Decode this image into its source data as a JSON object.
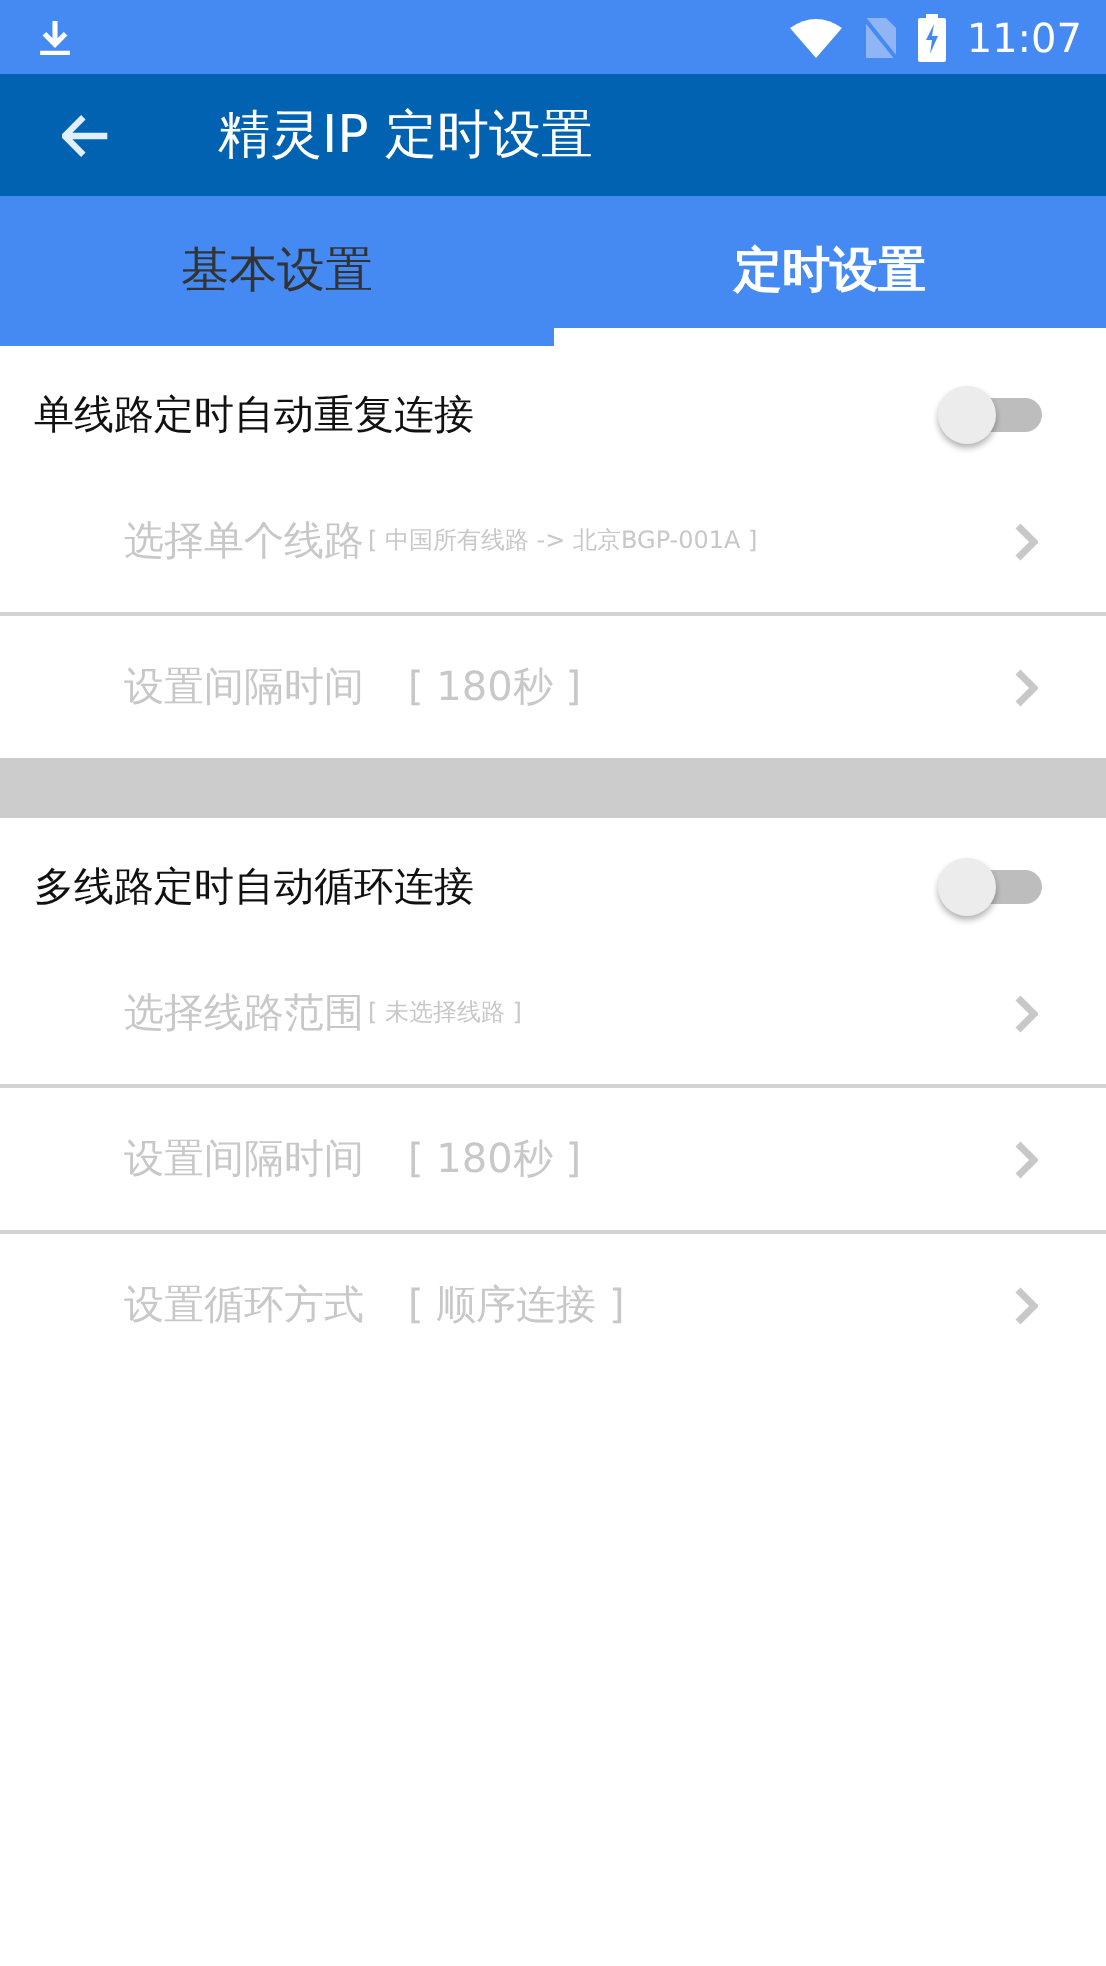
{
  "status_bar": {
    "time": "11:07"
  },
  "app_bar": {
    "title": "精灵IP 定时设置"
  },
  "tabs": [
    {
      "label": "基本设置",
      "selected": false
    },
    {
      "label": "定时设置",
      "selected": true
    }
  ],
  "sections": [
    {
      "title": "单线路定时自动重复连接",
      "on": false,
      "options": [
        {
          "label": "选择单个线路",
          "value": "[ 中国所有线路 -> 北京BGP-001A ]",
          "kind": "small",
          "disabled": true
        },
        {
          "label": "设置间隔时间",
          "value": "[ 180秒 ]",
          "kind": "spaced",
          "disabled": true
        }
      ]
    },
    {
      "title": "多线路定时自动循环连接",
      "on": false,
      "options": [
        {
          "label": "选择线路范围",
          "value": "[ 未选择线路 ]",
          "kind": "small",
          "disabled": true
        },
        {
          "label": "设置间隔时间",
          "value": "[ 180秒 ]",
          "kind": "spaced",
          "disabled": true
        },
        {
          "label": "设置循环方式",
          "value": "[ 顺序连接 ]",
          "kind": "spaced",
          "disabled": true
        }
      ]
    }
  ]
}
